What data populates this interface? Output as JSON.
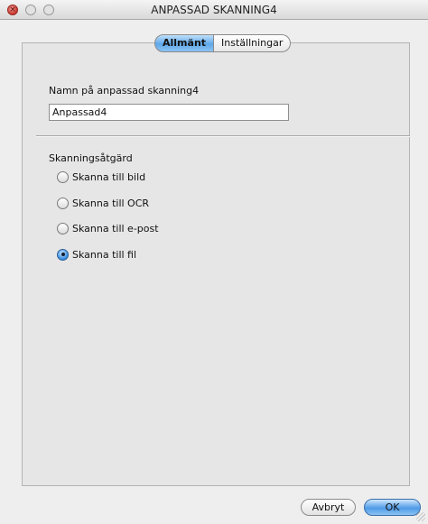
{
  "window": {
    "title": "ANPASSAD SKANNING4"
  },
  "tabs": [
    {
      "label": "Allmänt",
      "active": true
    },
    {
      "label": "Inställningar",
      "active": false
    }
  ],
  "name_section": {
    "label": "Namn på anpassad skanning4",
    "value": "Anpassad4"
  },
  "action_section": {
    "label": "Skanningsåtgärd",
    "options": [
      {
        "label": "Skanna till bild",
        "checked": false
      },
      {
        "label": "Skanna till OCR",
        "checked": false
      },
      {
        "label": "Skanna till e-post",
        "checked": false
      },
      {
        "label": "Skanna till fil",
        "checked": true
      }
    ]
  },
  "buttons": {
    "cancel": "Avbryt",
    "ok": "OK"
  },
  "colors": {
    "accent": "#5fa8ea",
    "close_button": "#c9362d"
  }
}
